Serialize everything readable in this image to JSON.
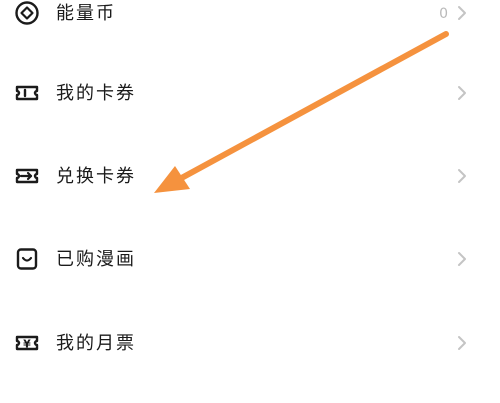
{
  "menu": {
    "items": [
      {
        "label": "能量币",
        "value": "0",
        "icon": "energy-coin-icon"
      },
      {
        "label": "我的卡券",
        "icon": "ticket-icon"
      },
      {
        "label": "兑换卡券",
        "icon": "exchange-ticket-icon"
      },
      {
        "label": "已购漫画",
        "icon": "purchased-comics-icon"
      },
      {
        "label": "我的月票",
        "icon": "monthly-ticket-icon"
      }
    ]
  },
  "annotation": {
    "color": "#f5923e"
  }
}
